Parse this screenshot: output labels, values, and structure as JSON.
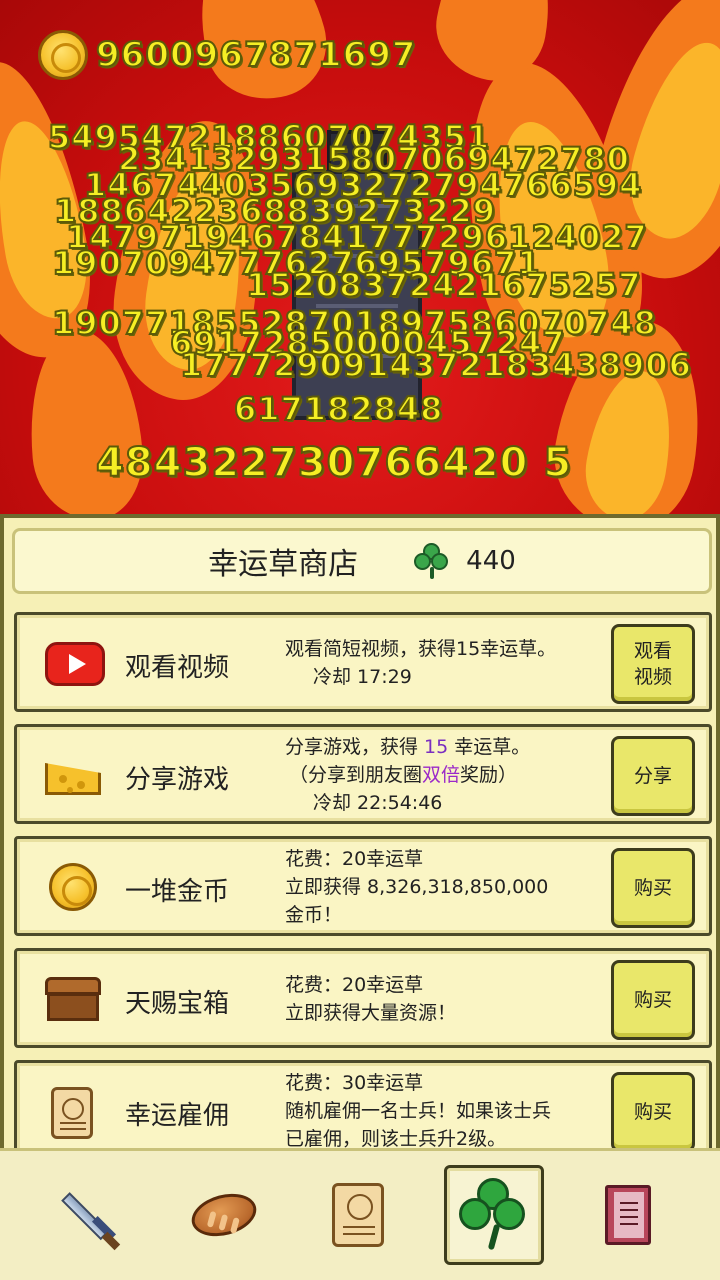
{
  "coins": "9600967871697",
  "floating_numbers": [
    "5495472188607074351",
    "2341329315807069472780",
    "146744035693272794766594",
    "1886422368839273229",
    "1479719467841777296124027",
    "190709477762769579671",
    "15208372421675257",
    "19077185528701897586070748",
    "69172850000457247",
    "1777290914372183438906",
    "617182848",
    "484322730766420 5"
  ],
  "shop": {
    "title": "幸运草商店",
    "clover_count": "440",
    "items": [
      {
        "icon": "video-play-icon",
        "name": "观看视频",
        "desc_line1": "观看简短视频，获得15幸运草。",
        "desc_line2": "冷却 17:29",
        "button": "观看视频"
      },
      {
        "icon": "cheese-icon",
        "name": "分享游戏",
        "desc_line1_pre": "分享游戏，获得 ",
        "desc_line1_num": "15",
        "desc_line1_post": " 幸运草。",
        "desc_line2_pre": "（分享到朋友圈",
        "desc_line2_hl": "双倍",
        "desc_line2_post": "奖励）",
        "desc_line3": "冷却 22:54:46",
        "button": "分享"
      },
      {
        "icon": "gold-coin-icon",
        "name": "一堆金币",
        "desc_line1": "花费：20幸运草",
        "desc_line2": "立即获得 8,326,318,850,000",
        "desc_line3": "金币！",
        "button": "购买"
      },
      {
        "icon": "treasure-chest-icon",
        "name": "天赐宝箱",
        "desc_line1": "花费：20幸运草",
        "desc_line2": "立即获得大量资源！",
        "button": "购买"
      },
      {
        "icon": "scroll-icon",
        "name": "幸运雇佣",
        "desc_line1": "花费：30幸运草",
        "desc_line2": "随机雇佣一名士兵！如果该士兵",
        "desc_line3": "已雇佣，则该士兵升2级。",
        "button": "购买"
      }
    ]
  },
  "nav": [
    "sword-icon",
    "bread-icon",
    "scroll-icon",
    "clover-icon",
    "book-icon"
  ],
  "nav_active": "clover-icon"
}
